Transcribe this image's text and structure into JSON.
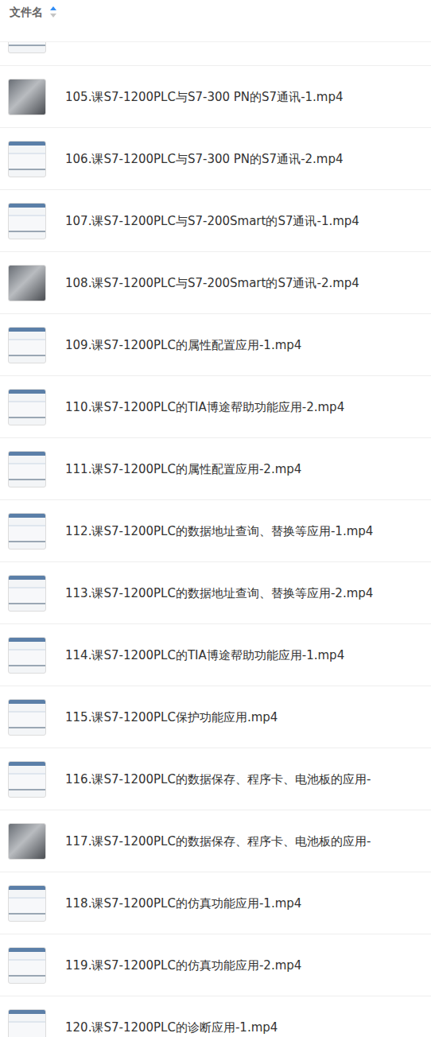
{
  "header": {
    "label": "文件名",
    "sort": "ascending"
  },
  "files": [
    {
      "name": "",
      "kind": "screen"
    },
    {
      "name": "105.课S7-1200PLC与S7-300 PN的S7通讯-1.mp4",
      "kind": "photo"
    },
    {
      "name": "106.课S7-1200PLC与S7-300 PN的S7通讯-2.mp4",
      "kind": "screen"
    },
    {
      "name": "107.课S7-1200PLC与S7-200Smart的S7通讯-1.mp4",
      "kind": "screen"
    },
    {
      "name": "108.课S7-1200PLC与S7-200Smart的S7通讯-2.mp4",
      "kind": "photo"
    },
    {
      "name": "109.课S7-1200PLC的属性配置应用-1.mp4",
      "kind": "screen"
    },
    {
      "name": "110.课S7-1200PLC的TIA博途帮助功能应用-2.mp4",
      "kind": "screen"
    },
    {
      "name": "111.课S7-1200PLC的属性配置应用-2.mp4",
      "kind": "screen"
    },
    {
      "name": "112.课S7-1200PLC的数据地址查询、替换等应用-1.mp4",
      "kind": "screen"
    },
    {
      "name": "113.课S7-1200PLC的数据地址查询、替换等应用-2.mp4",
      "kind": "screen"
    },
    {
      "name": "114.课S7-1200PLC的TIA博途帮助功能应用-1.mp4",
      "kind": "screen"
    },
    {
      "name": "115.课S7-1200PLC保护功能应用.mp4",
      "kind": "screen"
    },
    {
      "name": "116.课S7-1200PLC的数据保存、程序卡、电池板的应用-",
      "kind": "screen"
    },
    {
      "name": "117.课S7-1200PLC的数据保存、程序卡、电池板的应用-",
      "kind": "photo"
    },
    {
      "name": "118.课S7-1200PLC的仿真功能应用-1.mp4",
      "kind": "screen"
    },
    {
      "name": "119.课S7-1200PLC的仿真功能应用-2.mp4",
      "kind": "screen"
    },
    {
      "name": "120.课S7-1200PLC的诊断应用-1.mp4",
      "kind": "screen"
    }
  ]
}
